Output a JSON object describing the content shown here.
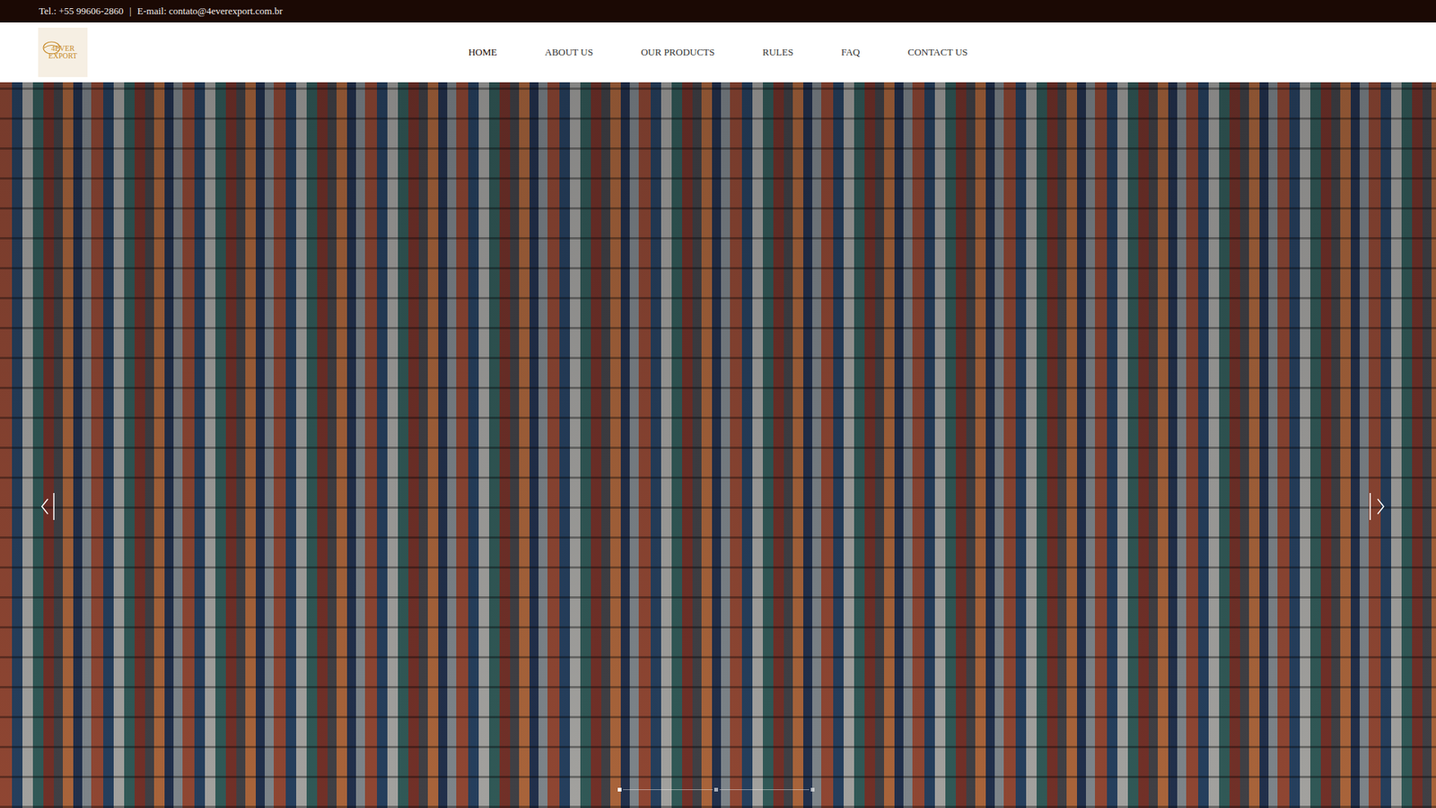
{
  "top_bar": {
    "phone": "Tel.: +55 99606-2860",
    "separator": "|",
    "email": "E-mail: contato@4everexport.com.br"
  },
  "logo": {
    "line1": "4EVER",
    "line2": "EXPORT"
  },
  "nav": [
    {
      "label": "HOME",
      "selected": true
    },
    {
      "label": "ABOUT US",
      "selected": false
    },
    {
      "label": "OUR PRODUCTS",
      "selected": false
    },
    {
      "label": "RULES",
      "selected": false
    },
    {
      "label": "FAQ",
      "selected": false
    },
    {
      "label": "CONTACT US",
      "selected": false
    }
  ],
  "slider": {
    "slides": [
      {
        "selected": true
      },
      {
        "selected": false
      },
      {
        "selected": false
      }
    ]
  }
}
